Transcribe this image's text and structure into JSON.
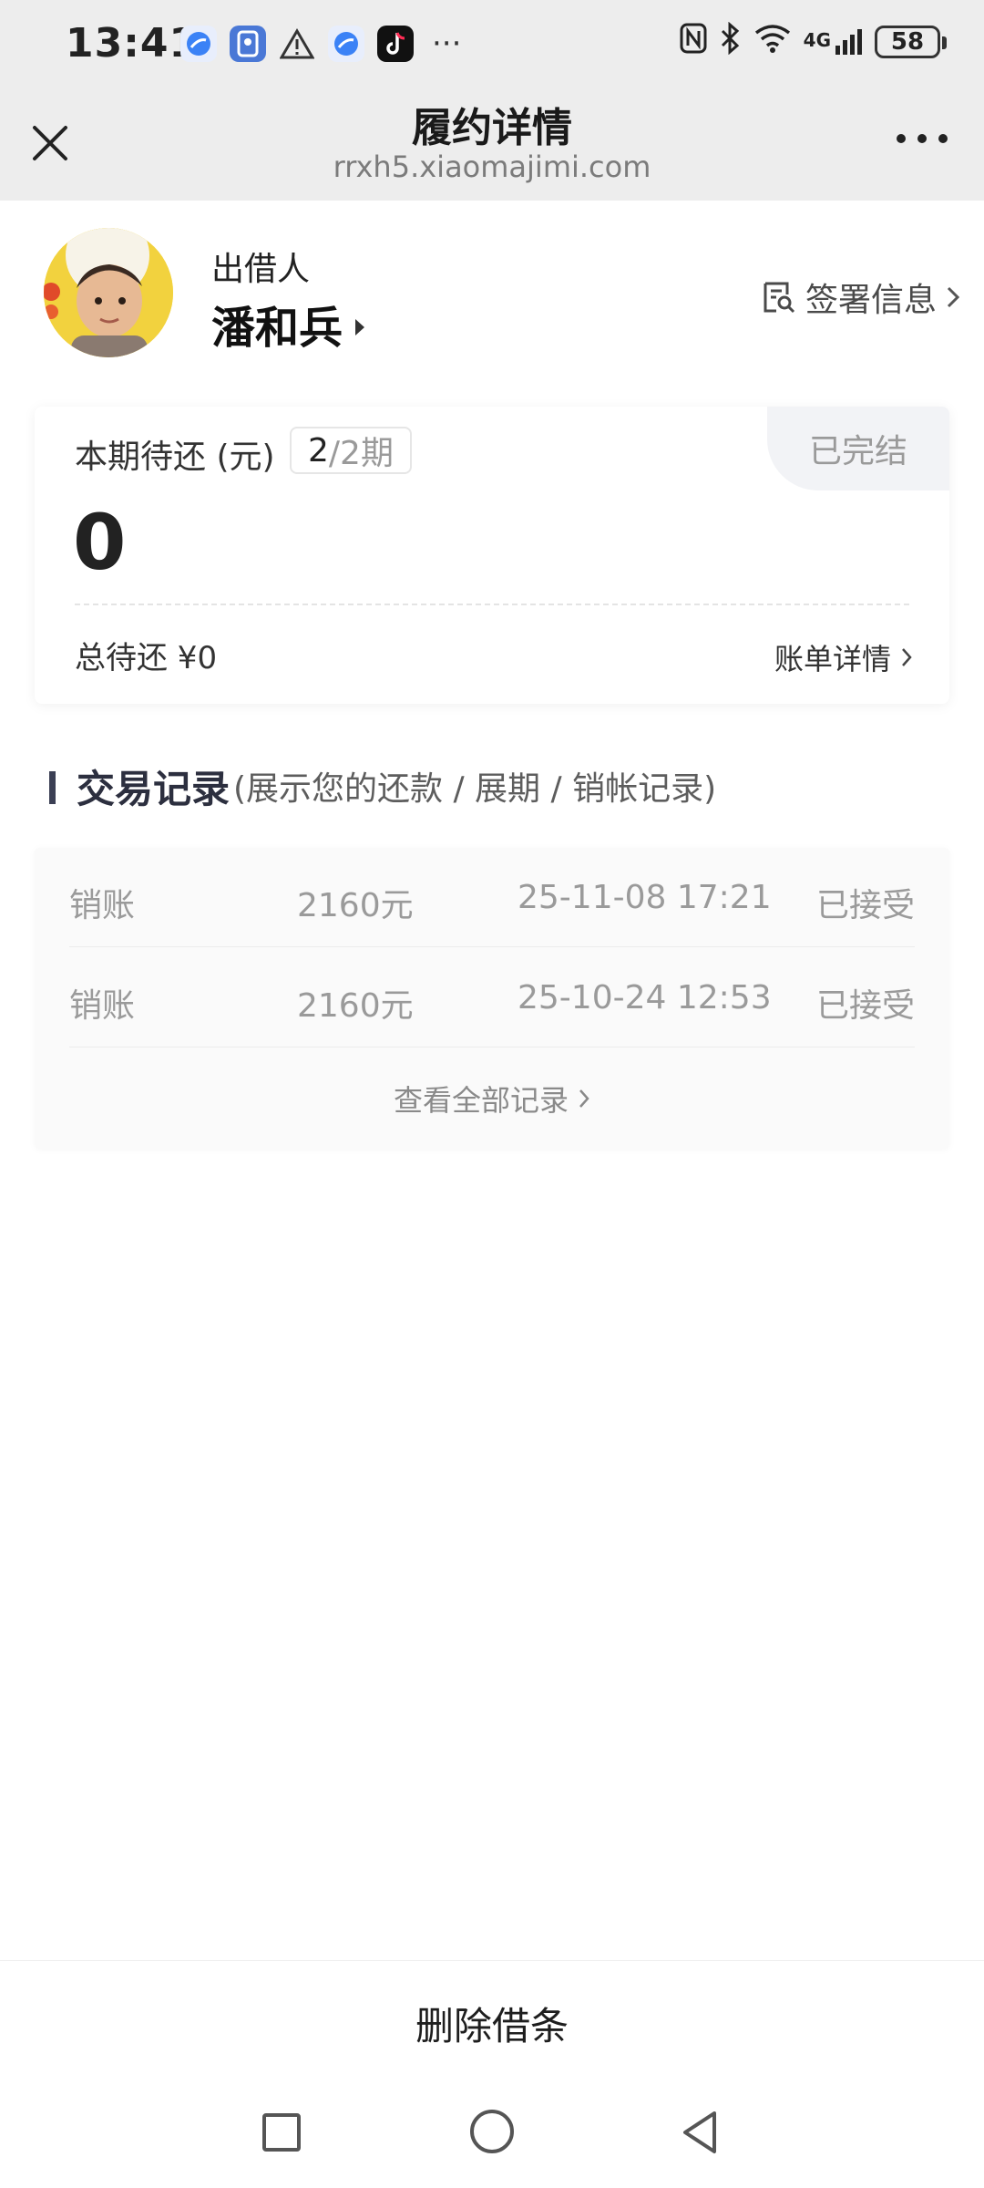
{
  "status_bar": {
    "time": "13:41",
    "apps": [
      {
        "icon": "browser-icon",
        "color": "#3b82f6"
      },
      {
        "icon": "wallet-app-icon",
        "color": "#4a78d6"
      },
      {
        "icon": "warning-icon",
        "color": "#333333"
      },
      {
        "icon": "browser-icon",
        "color": "#3b82f6"
      },
      {
        "icon": "tiktok-icon",
        "color": "#111111"
      }
    ],
    "more": "···",
    "signal_label": "4G",
    "battery": "58"
  },
  "header": {
    "title": "履约详情",
    "url": "rrxh5.xiaomajimi.com"
  },
  "lender": {
    "role": "出借人",
    "name": "潘和兵",
    "sign_info": "签署信息"
  },
  "summary_card": {
    "period_label": "本期待还 (元)",
    "period_current": "2",
    "period_total": "/2期",
    "status": "已完结",
    "amount": "0",
    "total_due": "总待还 ¥0",
    "bill_details": "账单详情"
  },
  "transactions": {
    "title": "交易记录",
    "subtitle": "(展示您的还款 / 展期 / 销帐记录)",
    "rows": [
      {
        "type": "销账",
        "amount": "2160元",
        "time": "25-11-08 17:21",
        "status": "已接受"
      },
      {
        "type": "销账",
        "amount": "2160元",
        "time": "25-10-24 12:53",
        "status": "已接受"
      }
    ],
    "view_all": "查看全部记录"
  },
  "bottom": {
    "delete_label": "删除借条"
  },
  "colors": {
    "header_bg": "#ededed",
    "accent_dark": "#2c2f3f",
    "muted_text": "#9a9a9a"
  }
}
